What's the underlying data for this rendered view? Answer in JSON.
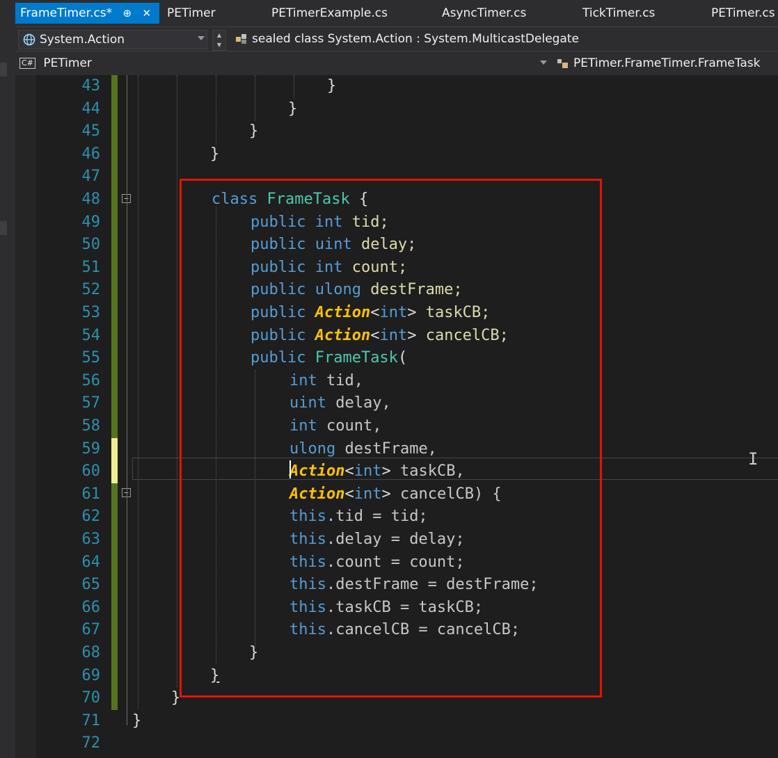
{
  "tabs": [
    {
      "label": "FrameTimer.cs*",
      "pin": "⊕",
      "close": "✕"
    },
    {
      "label": "PETimer"
    },
    {
      "label": "PETimerExample.cs"
    },
    {
      "label": "AsyncTimer.cs"
    },
    {
      "label": "TickTimer.cs"
    },
    {
      "label": "PETimer.cs"
    }
  ],
  "nav1": {
    "member": "System.Action",
    "signature": "sealed class System.Action : System.MulticastDelegate"
  },
  "nav2": {
    "project": "PETimer",
    "project_badge": "C#",
    "scope": "PETimer.FrameTimer.FrameTask"
  },
  "editor": {
    "line_numbers": [
      "43",
      "44",
      "45",
      "46",
      "47",
      "48",
      "49",
      "50",
      "51",
      "52",
      "53",
      "54",
      "55",
      "56",
      "57",
      "58",
      "59",
      "60",
      "61",
      "62",
      "63",
      "64",
      "65",
      "66",
      "67",
      "68",
      "69",
      "70",
      "71",
      "72"
    ],
    "lines": {
      "l43": "}",
      "l44": "}",
      "l45": "}",
      "l46": "}",
      "l48a": "class ",
      "l48b": "FrameTask",
      "l48c": " {",
      "l49a": "public ",
      "l49b": "int",
      "l49c": " tid;",
      "l50a": "public ",
      "l50b": "uint",
      "l50c": " delay;",
      "l51a": "public ",
      "l51b": "int",
      "l51c": " count;",
      "l52a": "public ",
      "l52b": "ulong",
      "l52c": " destFrame;",
      "l53a": "public ",
      "l53b": "Action",
      "l53c": "<",
      "l53d": "int",
      "l53e": "> ",
      "l53f": "taskCB;",
      "l54a": "public ",
      "l54b": "Action",
      "l54c": "<",
      "l54d": "int",
      "l54e": "> ",
      "l54f": "cancelCB;",
      "l55a": "public ",
      "l55b": "FrameTask",
      "l55c": "(",
      "l56a": "int",
      "l56b": " tid,",
      "l57a": "uint",
      "l57b": " delay,",
      "l58a": "int",
      "l58b": " count,",
      "l59a": "ulong",
      "l59b": " destFrame,",
      "l60a": "Action",
      "l60b": "<",
      "l60c": "int",
      "l60d": "> ",
      "l60e": "taskCB,",
      "l61a": "Action",
      "l61b": "<",
      "l61c": "int",
      "l61d": "> ",
      "l61e": "cancelCB) {",
      "l62a": "this",
      "l62b": ".tid = tid;",
      "l63a": "this",
      "l63b": ".delay = delay;",
      "l64a": "this",
      "l64b": ".count = count;",
      "l65a": "this",
      "l65b": ".destFrame = destFrame;",
      "l66a": "this",
      "l66b": ".taskCB = taskCB;",
      "l67a": "this",
      "l67b": ".cancelCB = cancelCB;",
      "l68": "}",
      "l69": "}",
      "l70": "}",
      "l71": "}"
    },
    "fold_glyph": "−"
  },
  "colors": {
    "keyword": "#569cd6",
    "type": "#4ec9b0",
    "action": "#ffc000",
    "line_number": "#2b91af",
    "highlight_box": "#e51400",
    "tab_active": "#007acc",
    "change_saved": "#56731f",
    "change_unsaved": "#efef8f"
  },
  "icons": [
    "globe-icon",
    "class-icon",
    "csharp-project-icon",
    "scope-icon",
    "ibeam-cursor-icon",
    "pin-icon",
    "close-icon"
  ]
}
